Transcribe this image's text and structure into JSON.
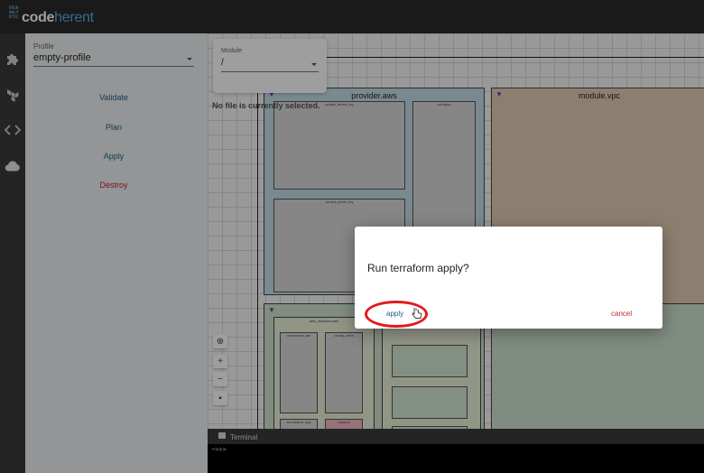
{
  "brand": {
    "part1": "code",
    "part2": "herent",
    "mark_lines": [
      "ERIN",
      "ANLY",
      "RTIC"
    ]
  },
  "sidebar": {
    "icons": [
      "puzzle-icon",
      "terraform-icon",
      "code-icon",
      "cloud-icon"
    ]
  },
  "panel": {
    "profile_label": "Profile",
    "profile_value": "empty-profile",
    "actions": {
      "validate": "Validate",
      "plan": "Plan",
      "apply": "Apply",
      "destroy": "Destroy"
    }
  },
  "module": {
    "label": "Module",
    "value": "/"
  },
  "no_file": "No file is currently selected.",
  "diagram": {
    "provider_title": "provider.aws",
    "module_vpc_title": "module.vpc",
    "lower_title": "ran",
    "nodes": {
      "n1": "var.aws_access_key",
      "n2": "var.region",
      "n3": "var.aws_secret_key",
      "n4": "aws_instance.web",
      "n5": "var.instance_ami",
      "n6": "var.key_name",
      "n7": "aws_instance.web",
      "n8": "var.instance_type",
      "n9": "output.ip"
    }
  },
  "zoom": {
    "controls": [
      "⊕",
      "+",
      "−",
      "▪"
    ]
  },
  "terminal": {
    "label": "Terminal",
    "prompt": "~>>>"
  },
  "dialog": {
    "title": "Run terraform apply?",
    "apply_label": "apply",
    "cancel_label": "cancel"
  },
  "colors": {
    "accent": "#1f5f86",
    "danger": "#b3282e",
    "topbar": "#2b2b2b",
    "highlight": "#e3191f"
  }
}
